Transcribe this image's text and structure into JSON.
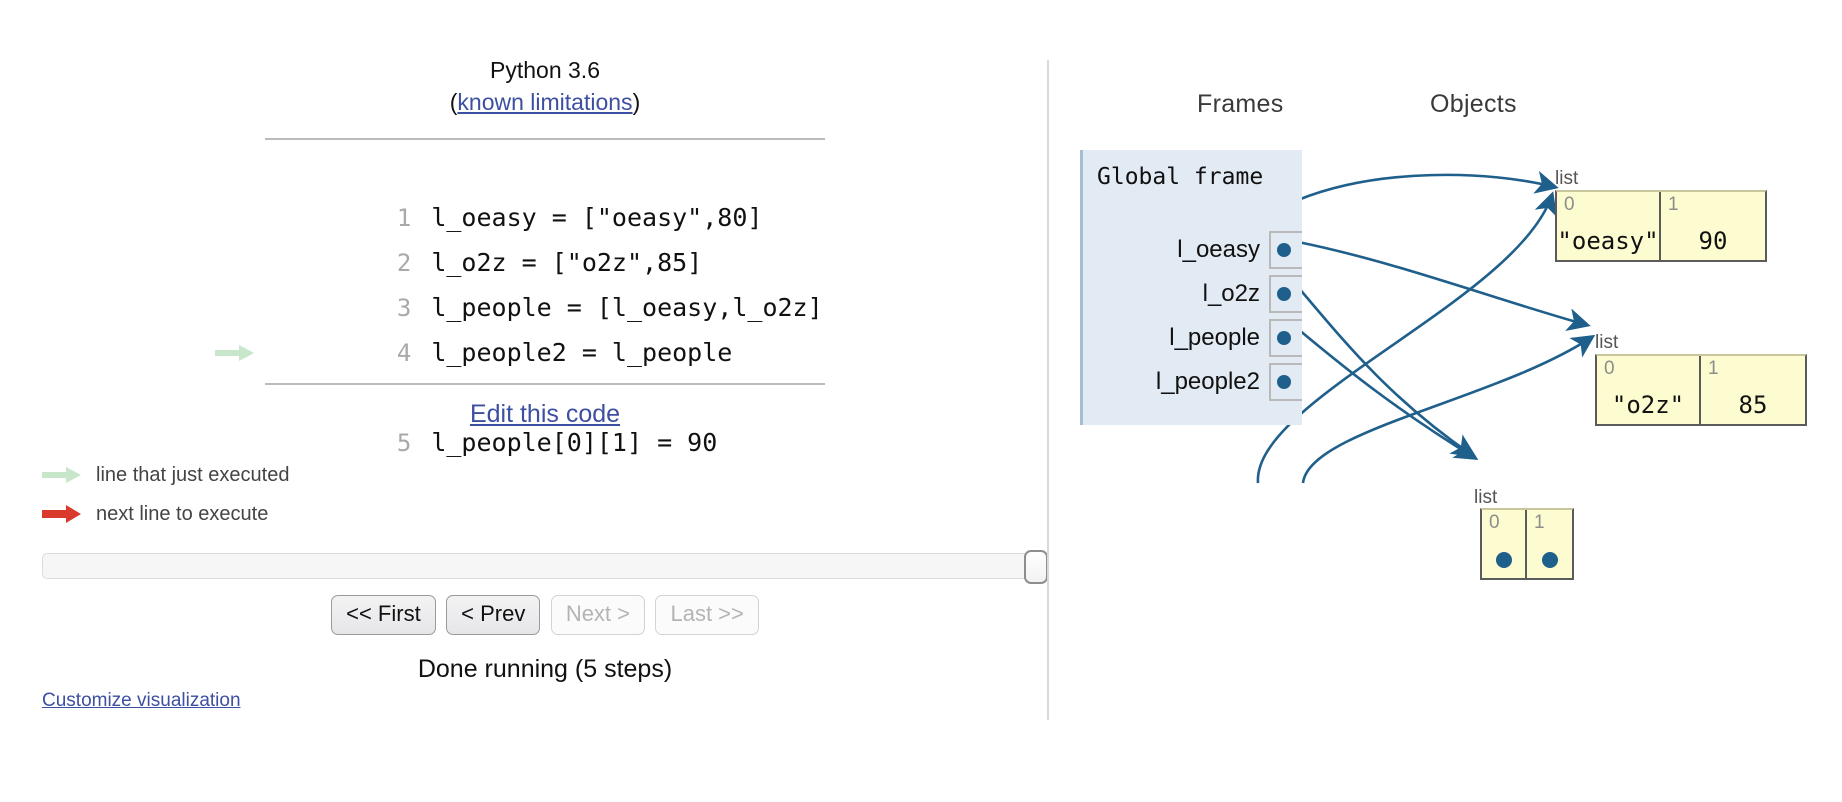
{
  "code_panel": {
    "python_version": "Python 3.6",
    "limitations_prefix": "(",
    "limitations_link": "known limitations",
    "limitations_suffix": ")",
    "lines": [
      {
        "number": "1",
        "text": "l_oeasy = [\"oeasy\",80]",
        "marker": "none"
      },
      {
        "number": "2",
        "text": "l_o2z = [\"o2z\",85]",
        "marker": "none"
      },
      {
        "number": "3",
        "text": "l_people = [l_oeasy,l_o2z]",
        "marker": "none"
      },
      {
        "number": "4",
        "text": "l_people2 = l_people",
        "marker": "none"
      },
      {
        "number": "5",
        "text": "l_people[0][1] = 90",
        "marker": "just-executed"
      }
    ],
    "edit_link": "Edit this code"
  },
  "legend": {
    "items": [
      {
        "icon": "green-arrow-icon",
        "label": "line that just executed",
        "color": "#c8e6c9"
      },
      {
        "icon": "red-arrow-icon",
        "label": "next line to execute",
        "color": "#d93a2b"
      }
    ]
  },
  "controls": {
    "buttons": [
      {
        "label": "<< First",
        "enabled": true
      },
      {
        "label": "< Prev",
        "enabled": true
      },
      {
        "label": "Next >",
        "enabled": false
      },
      {
        "label": "Last >>",
        "enabled": false
      }
    ],
    "slider_value_percent": 100,
    "status": "Done running (5 steps)"
  },
  "customize_link": "Customize visualization",
  "viz": {
    "frames_header": "Frames",
    "objects_header": "Objects",
    "frame": {
      "title": "Global frame",
      "variables": [
        {
          "name": "l_oeasy",
          "points_to": "list-oeasy"
        },
        {
          "name": "l_o2z",
          "points_to": "list-o2z"
        },
        {
          "name": "l_people",
          "points_to": "list-people"
        },
        {
          "name": "l_people2",
          "points_to": "list-people"
        }
      ]
    },
    "objects": [
      {
        "id": "list-oeasy",
        "type_label": "list",
        "cells": [
          {
            "index": "0",
            "value": "\"oeasy\"",
            "is_pointer": false
          },
          {
            "index": "1",
            "value": "90",
            "is_pointer": false
          }
        ]
      },
      {
        "id": "list-o2z",
        "type_label": "list",
        "cells": [
          {
            "index": "0",
            "value": "\"o2z\"",
            "is_pointer": false
          },
          {
            "index": "1",
            "value": "85",
            "is_pointer": false
          }
        ]
      },
      {
        "id": "list-people",
        "type_label": "list",
        "cells": [
          {
            "index": "0",
            "value": "",
            "is_pointer": true
          },
          {
            "index": "1",
            "value": "",
            "is_pointer": true
          }
        ]
      }
    ],
    "colors": {
      "frame_bg": "#e2eaf3",
      "object_bg": "#fdfbd0",
      "pointer": "#1f5f8b",
      "link": "#3d4fa1"
    }
  }
}
